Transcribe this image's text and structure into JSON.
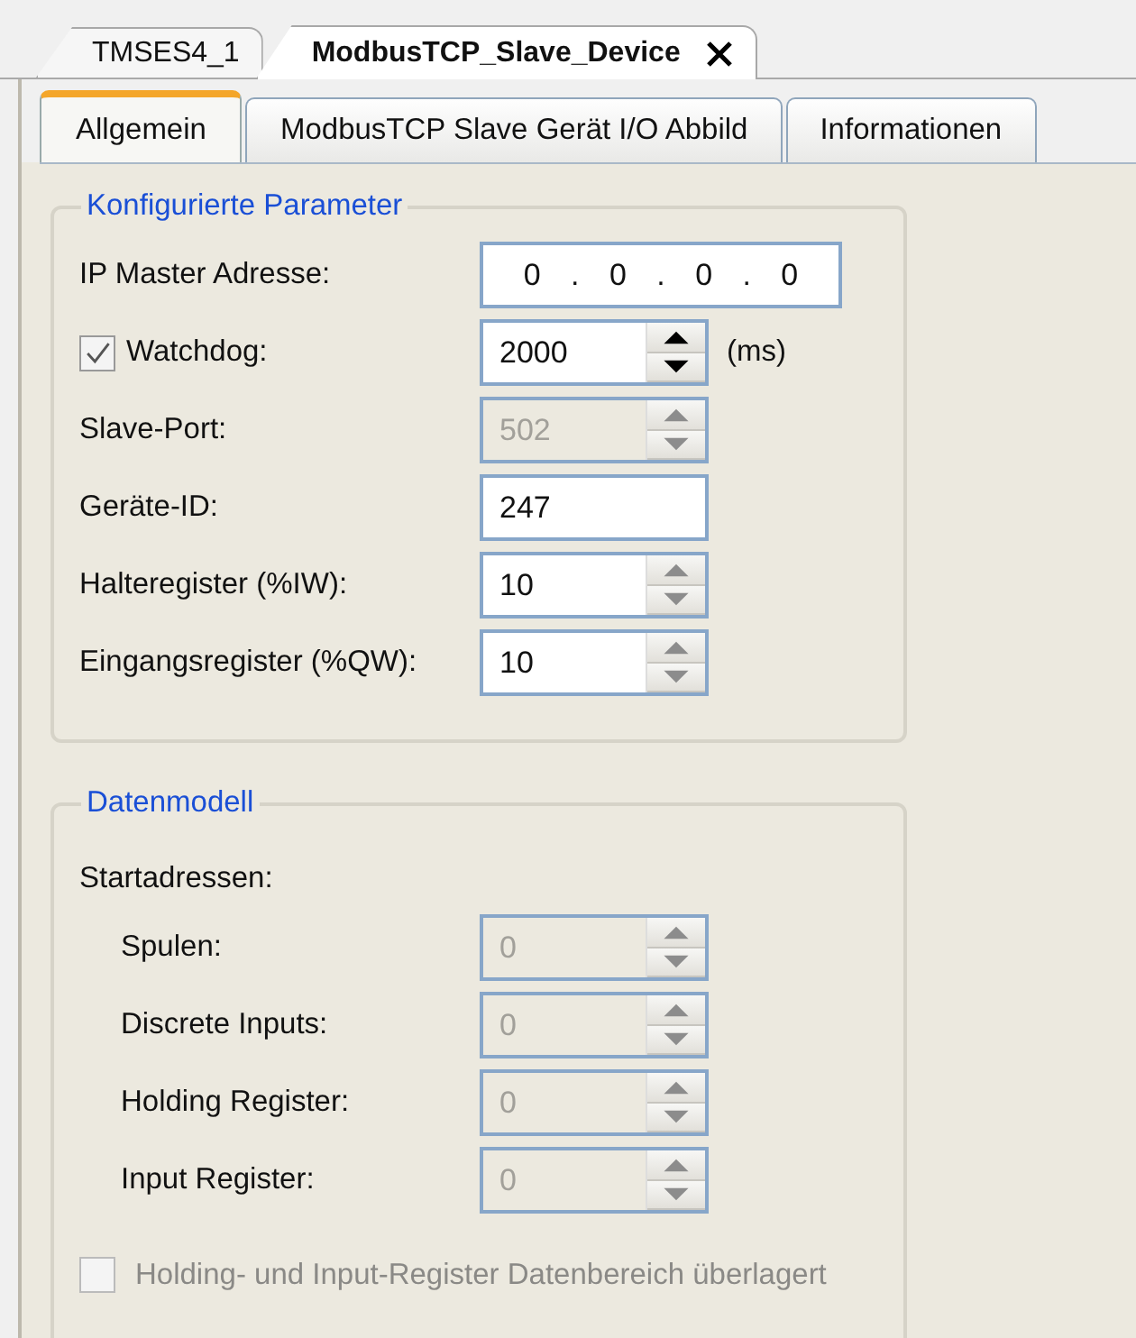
{
  "document_tabs": [
    {
      "label": "TMSES4_1",
      "selected": false,
      "closable": false
    },
    {
      "label": "ModbusTCP_Slave_Device",
      "selected": true,
      "closable": true
    }
  ],
  "tabs": [
    {
      "label": "Allgemein",
      "selected": true
    },
    {
      "label": "ModbusTCP Slave Gerät I/O Abbild",
      "selected": false
    },
    {
      "label": "Informationen",
      "selected": false
    }
  ],
  "groups": [
    {
      "title": "Konfigurierte Parameter",
      "rows": [
        {
          "kind": "ip",
          "label": "IP Master Adresse:",
          "octets": [
            "0",
            "0",
            "0",
            "0"
          ],
          "separator": "."
        },
        {
          "kind": "spin",
          "label": "Watchdog:",
          "checked": true,
          "value": "2000",
          "unit": "(ms)",
          "disabled": false,
          "buttons_disabled": false
        },
        {
          "kind": "spin",
          "label": "Slave-Port:",
          "value": "502",
          "disabled": true,
          "buttons_disabled": true
        },
        {
          "kind": "text",
          "label": "Geräte-ID:",
          "value": "247",
          "disabled": false
        },
        {
          "kind": "spin",
          "label": "Halteregister (%IW):",
          "value": "10",
          "disabled": false,
          "buttons_disabled": true
        },
        {
          "kind": "spin",
          "label": "Eingangsregister (%QW):",
          "value": "10",
          "disabled": false,
          "buttons_disabled": true
        }
      ]
    },
    {
      "title": "Datenmodell",
      "rows": [
        {
          "kind": "heading",
          "label": "Startadressen:",
          "children": [
            {
              "kind": "spin",
              "label": "Spulen:",
              "value": "0",
              "disabled": true,
              "buttons_disabled": true
            },
            {
              "kind": "spin",
              "label": "Discrete Inputs:",
              "value": "0",
              "disabled": true,
              "buttons_disabled": true
            },
            {
              "kind": "spin",
              "label": "Holding Register:",
              "value": "0",
              "disabled": true,
              "buttons_disabled": true
            },
            {
              "kind": "spin",
              "label": "Input Register:",
              "value": "0",
              "disabled": true,
              "buttons_disabled": true
            }
          ]
        },
        {
          "kind": "check",
          "label": "Holding- und Input-Register Datenbereich überlagert",
          "checked": false,
          "disabled": true
        }
      ]
    }
  ]
}
